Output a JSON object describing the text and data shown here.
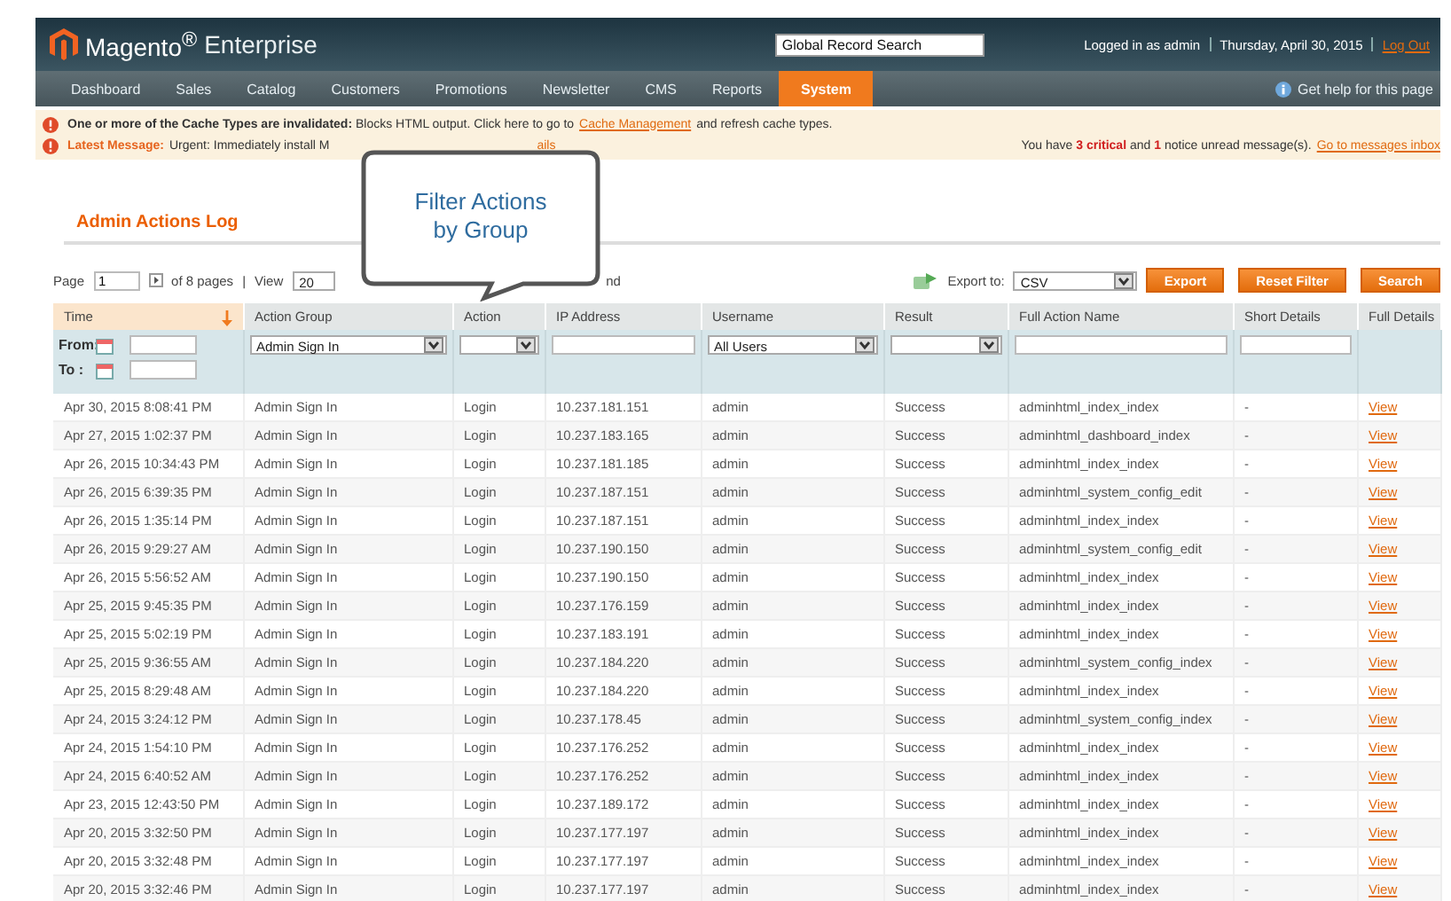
{
  "header": {
    "logo": "Magento$^{®}$",
    "logo_sub": "Enterprise",
    "search": {
      "placeholder": "Global Record Search"
    },
    "user": "Logged in as admin",
    "date": "Thursday, April 30, 2015",
    "logout": "Log Out"
  },
  "nav": {
    "items": [
      {
        "label": "Dashboard",
        "selected": false
      },
      {
        "label": "Sales",
        "selected": false
      },
      {
        "label": "Catalog",
        "selected": false
      },
      {
        "label": "Customers",
        "selected": false
      },
      {
        "label": "Promotions",
        "selected": false
      },
      {
        "label": "Newsletter",
        "selected": false
      },
      {
        "label": "CMS",
        "selected": false
      },
      {
        "label": "Reports",
        "selected": false
      },
      {
        "label": "System",
        "selected": true
      }
    ],
    "help": "Get help for this page"
  },
  "notices": {
    "cache": {
      "text": "**One or more of the Cache Types are invalidated:** Blocks HTML output. Click here to go to",
      "link": "Cache Management",
      "after": "and refresh cache types."
    },
    "latest": {
      "label": "Latest Message:",
      "text": "Urgent: Immediately install M",
      "link": "ails",
      "summary": "You have **3 critical** and **1** notice unread message(s).",
      "inbox": "Go to messages inbox"
    }
  },
  "title": "Admin Actions Log",
  "pager": {
    "page_label": "Page",
    "page": "1",
    "of": "of 8 pages",
    "sep": "|",
    "view_label": "View",
    "view": "20",
    "tail": "nd"
  },
  "export": {
    "label": "Export to:",
    "format": "CSV",
    "button": "Export"
  },
  "buttons": [
    "Reset Filter",
    "Search"
  ],
  "columns": [
    {
      "name": "Time",
      "sorted": true
    },
    {
      "name": "Action Group",
      "sorted": false
    },
    {
      "name": "Action",
      "sorted": false
    },
    {
      "name": "IP Address",
      "sorted": false
    },
    {
      "name": "Username",
      "sorted": false
    },
    {
      "name": "Result",
      "sorted": false
    },
    {
      "name": "Full Action Name",
      "sorted": false
    },
    {
      "name": "Short Details",
      "sorted": false
    },
    {
      "name": "Full Details",
      "sorted": false
    }
  ],
  "filters": [
    {
      "kind": "date",
      "from": "From:",
      "to": "To :"
    },
    {
      "kind": "select",
      "value": "Admin Sign In"
    },
    {
      "kind": "select"
    },
    {
      "kind": "text"
    },
    {
      "kind": "select",
      "value": "All Users"
    },
    {
      "kind": "select"
    },
    {
      "kind": "text"
    },
    {
      "kind": "text"
    },
    {
      "kind": "none"
    }
  ],
  "rows": [
    [
      "Apr 30, 2015 8:08:41 PM",
      "Admin Sign In",
      "Login",
      "10.237.181.151",
      "admin",
      "Success",
      "adminhtml_index_index",
      "-",
      "View"
    ],
    [
      "Apr 27, 2015 1:02:37 PM",
      "Admin Sign In",
      "Login",
      "10.237.183.165",
      "admin",
      "Success",
      "adminhtml_dashboard_index",
      "-",
      "View"
    ],
    [
      "Apr 26, 2015 10:34:43 PM",
      "Admin Sign In",
      "Login",
      "10.237.181.185",
      "admin",
      "Success",
      "adminhtml_index_index",
      "-",
      "View"
    ],
    [
      "Apr 26, 2015 6:39:35 PM",
      "Admin Sign In",
      "Login",
      "10.237.187.151",
      "admin",
      "Success",
      "adminhtml_system_config_edit",
      "-",
      "View"
    ],
    [
      "Apr 26, 2015 1:35:14 PM",
      "Admin Sign In",
      "Login",
      "10.237.187.151",
      "admin",
      "Success",
      "adminhtml_index_index",
      "-",
      "View"
    ],
    [
      "Apr 26, 2015 9:29:27 AM",
      "Admin Sign In",
      "Login",
      "10.237.190.150",
      "admin",
      "Success",
      "adminhtml_system_config_edit",
      "-",
      "View"
    ],
    [
      "Apr 26, 2015 5:56:52 AM",
      "Admin Sign In",
      "Login",
      "10.237.190.150",
      "admin",
      "Success",
      "adminhtml_index_index",
      "-",
      "View"
    ],
    [
      "Apr 25, 2015 9:45:35 PM",
      "Admin Sign In",
      "Login",
      "10.237.176.159",
      "admin",
      "Success",
      "adminhtml_index_index",
      "-",
      "View"
    ],
    [
      "Apr 25, 2015 5:02:19 PM",
      "Admin Sign In",
      "Login",
      "10.237.183.191",
      "admin",
      "Success",
      "adminhtml_index_index",
      "-",
      "View"
    ],
    [
      "Apr 25, 2015 9:36:55 AM",
      "Admin Sign In",
      "Login",
      "10.237.184.220",
      "admin",
      "Success",
      "adminhtml_system_config_index",
      "-",
      "View"
    ],
    [
      "Apr 25, 2015 8:29:48 AM",
      "Admin Sign In",
      "Login",
      "10.237.184.220",
      "admin",
      "Success",
      "adminhtml_index_index",
      "-",
      "View"
    ],
    [
      "Apr 24, 2015 3:24:12 PM",
      "Admin Sign In",
      "Login",
      "10.237.178.45",
      "admin",
      "Success",
      "adminhtml_system_config_index",
      "-",
      "View"
    ],
    [
      "Apr 24, 2015 1:54:10 PM",
      "Admin Sign In",
      "Login",
      "10.237.176.252",
      "admin",
      "Success",
      "adminhtml_index_index",
      "-",
      "View"
    ],
    [
      "Apr 24, 2015 6:40:52 AM",
      "Admin Sign In",
      "Login",
      "10.237.176.252",
      "admin",
      "Success",
      "adminhtml_index_index",
      "-",
      "View"
    ],
    [
      "Apr 23, 2015 12:43:50 PM",
      "Admin Sign In",
      "Login",
      "10.237.189.172",
      "admin",
      "Success",
      "adminhtml_index_index",
      "-",
      "View"
    ],
    [
      "Apr 20, 2015 3:32:50 PM",
      "Admin Sign In",
      "Login",
      "10.237.177.197",
      "admin",
      "Success",
      "adminhtml_index_index",
      "-",
      "View"
    ],
    [
      "Apr 20, 2015 3:32:48 PM",
      "Admin Sign In",
      "Login",
      "10.237.177.197",
      "admin",
      "Success",
      "adminhtml_index_index",
      "-",
      "View"
    ],
    [
      "Apr 20, 2015 3:32:46 PM",
      "Admin Sign In",
      "Login",
      "10.237.177.197",
      "admin",
      "Success",
      "adminhtml_index_index",
      "-",
      "View"
    ]
  ],
  "callout": "Filter Actions by Group"
}
